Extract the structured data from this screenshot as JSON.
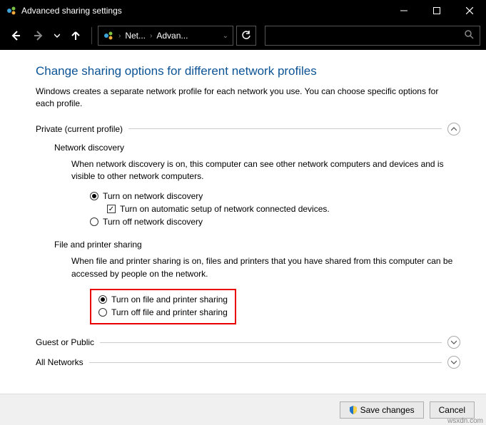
{
  "titlebar": {
    "title": "Advanced sharing settings"
  },
  "breadcrumb": {
    "part1": "Net...",
    "part2": "Advan..."
  },
  "heading": "Change sharing options for different network profiles",
  "subtext": "Windows creates a separate network profile for each network you use. You can choose specific options for each profile.",
  "private": {
    "header": "Private (current profile)",
    "discovery": {
      "label": "Network discovery",
      "desc": "When network discovery is on, this computer can see other network computers and devices and is visible to other network computers.",
      "on": "Turn on network discovery",
      "auto": "Turn on automatic setup of network connected devices.",
      "off": "Turn off network discovery"
    },
    "fps": {
      "label": "File and printer sharing",
      "desc": "When file and printer sharing is on, files and printers that you have shared from this computer can be accessed by people on the network.",
      "on": "Turn on file and printer sharing",
      "off": "Turn off file and printer sharing"
    }
  },
  "guest": {
    "header": "Guest or Public"
  },
  "allnet": {
    "header": "All Networks"
  },
  "footer": {
    "save": "Save changes",
    "cancel": "Cancel"
  },
  "watermark": "wsxdn.com"
}
